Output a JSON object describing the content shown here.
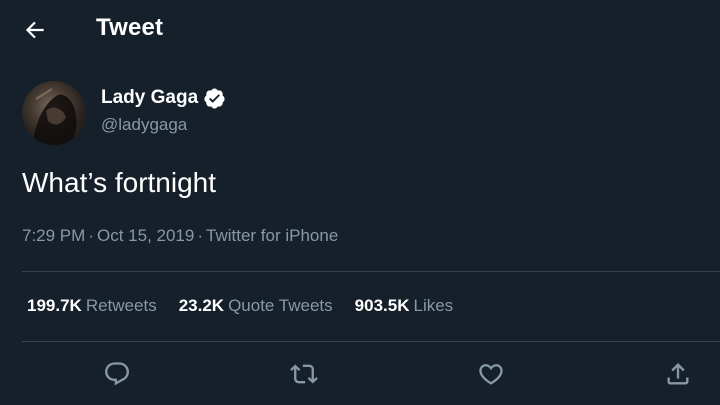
{
  "header": {
    "title": "Tweet",
    "back_icon": "arrow-left-icon"
  },
  "author": {
    "name": "Lady Gaga",
    "handle": "@ladygaga",
    "verified": true
  },
  "tweet": {
    "text": "What’s fortnight"
  },
  "meta": {
    "time": "7:29 PM",
    "separator": "·",
    "date": "Oct 15, 2019",
    "source": "Twitter for iPhone"
  },
  "stats": [
    {
      "value": "199.7K",
      "label": "Retweets"
    },
    {
      "value": "23.2K",
      "label": "Quote Tweets"
    },
    {
      "value": "903.5K",
      "label": "Likes"
    }
  ],
  "actions": [
    "reply-icon",
    "retweet-icon",
    "like-icon",
    "share-icon"
  ],
  "colors": {
    "background": "#15202b",
    "text": "#ffffff",
    "secondary": "#8899a6",
    "divider": "#38444d"
  }
}
